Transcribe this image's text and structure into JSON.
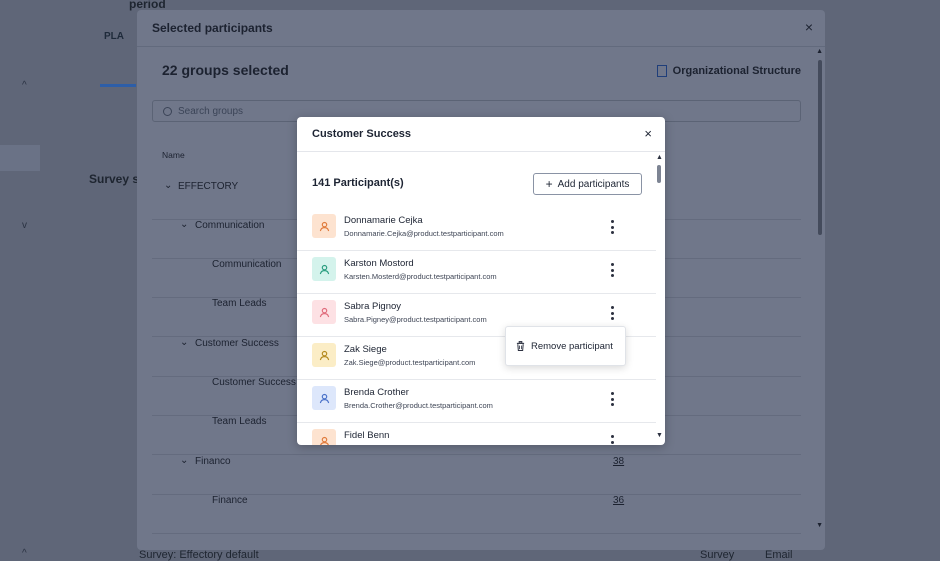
{
  "background": {
    "title": "period",
    "plan_label": "PLA",
    "survey_section": "Survey se",
    "bottom_text": "Survey: Effectory default",
    "tab_survey": "Survey",
    "tab_email": "Email"
  },
  "outer_modal": {
    "title": "Selected participants",
    "close_glyph": "×",
    "groups_selected": "22 groups selected",
    "org_structure_label": "Organizational Structure",
    "search_placeholder": "Search groups",
    "column_name": "Name",
    "tree": [
      {
        "label": "EFFECTORY",
        "level": 0,
        "expandable": true,
        "count": ""
      },
      {
        "label": "Communication",
        "level": 1,
        "expandable": true,
        "count": ""
      },
      {
        "label": "Communication",
        "level": 2,
        "expandable": false,
        "count": ""
      },
      {
        "label": "Team Leads",
        "level": 2,
        "expandable": false,
        "count": ""
      },
      {
        "label": "Customer Success",
        "level": 1,
        "expandable": true,
        "count": ""
      },
      {
        "label": "Customer Success",
        "level": 2,
        "expandable": false,
        "count": ""
      },
      {
        "label": "Team Leads",
        "level": 2,
        "expandable": false,
        "count": ""
      },
      {
        "label": "Financo",
        "level": 1,
        "expandable": true,
        "count": "38"
      },
      {
        "label": "Finance",
        "level": 2,
        "expandable": false,
        "count": "36"
      }
    ]
  },
  "inner_modal": {
    "title": "Customer Success",
    "close_glyph": "×",
    "participant_count": "141 Participant(s)",
    "add_button": "Add participants",
    "participants": [
      {
        "name": "Donnamarie Cejka",
        "email": "Donnamarie.Cejka@product.testparticipant.com",
        "avatar_bg": "#fde3d0",
        "avatar_fg": "#e07b3c"
      },
      {
        "name": "Karston Mostord",
        "email": "Karsten.Mosterd@product.testparticipant.com",
        "avatar_bg": "#d4f3ec",
        "avatar_fg": "#2a9d7f"
      },
      {
        "name": "Sabra Pignoy",
        "email": "Sabra.Pigney@product.testparticipant.com",
        "avatar_bg": "#fde1e4",
        "avatar_fg": "#e06b7b"
      },
      {
        "name": "Zak Siege",
        "email": "Zak.Siege@product.testparticipant.com",
        "avatar_bg": "#fbedc6",
        "avatar_fg": "#b48a1e"
      },
      {
        "name": "Brenda Crother",
        "email": "Brenda.Crother@product.testparticipant.com",
        "avatar_bg": "#dde7fb",
        "avatar_fg": "#4a72c9"
      },
      {
        "name": "Fidel Benn",
        "email": "",
        "avatar_bg": "#fde3d0",
        "avatar_fg": "#e07b3c"
      }
    ],
    "context_menu": {
      "remove_label": "Remove participant",
      "icon": "trash-icon"
    }
  }
}
